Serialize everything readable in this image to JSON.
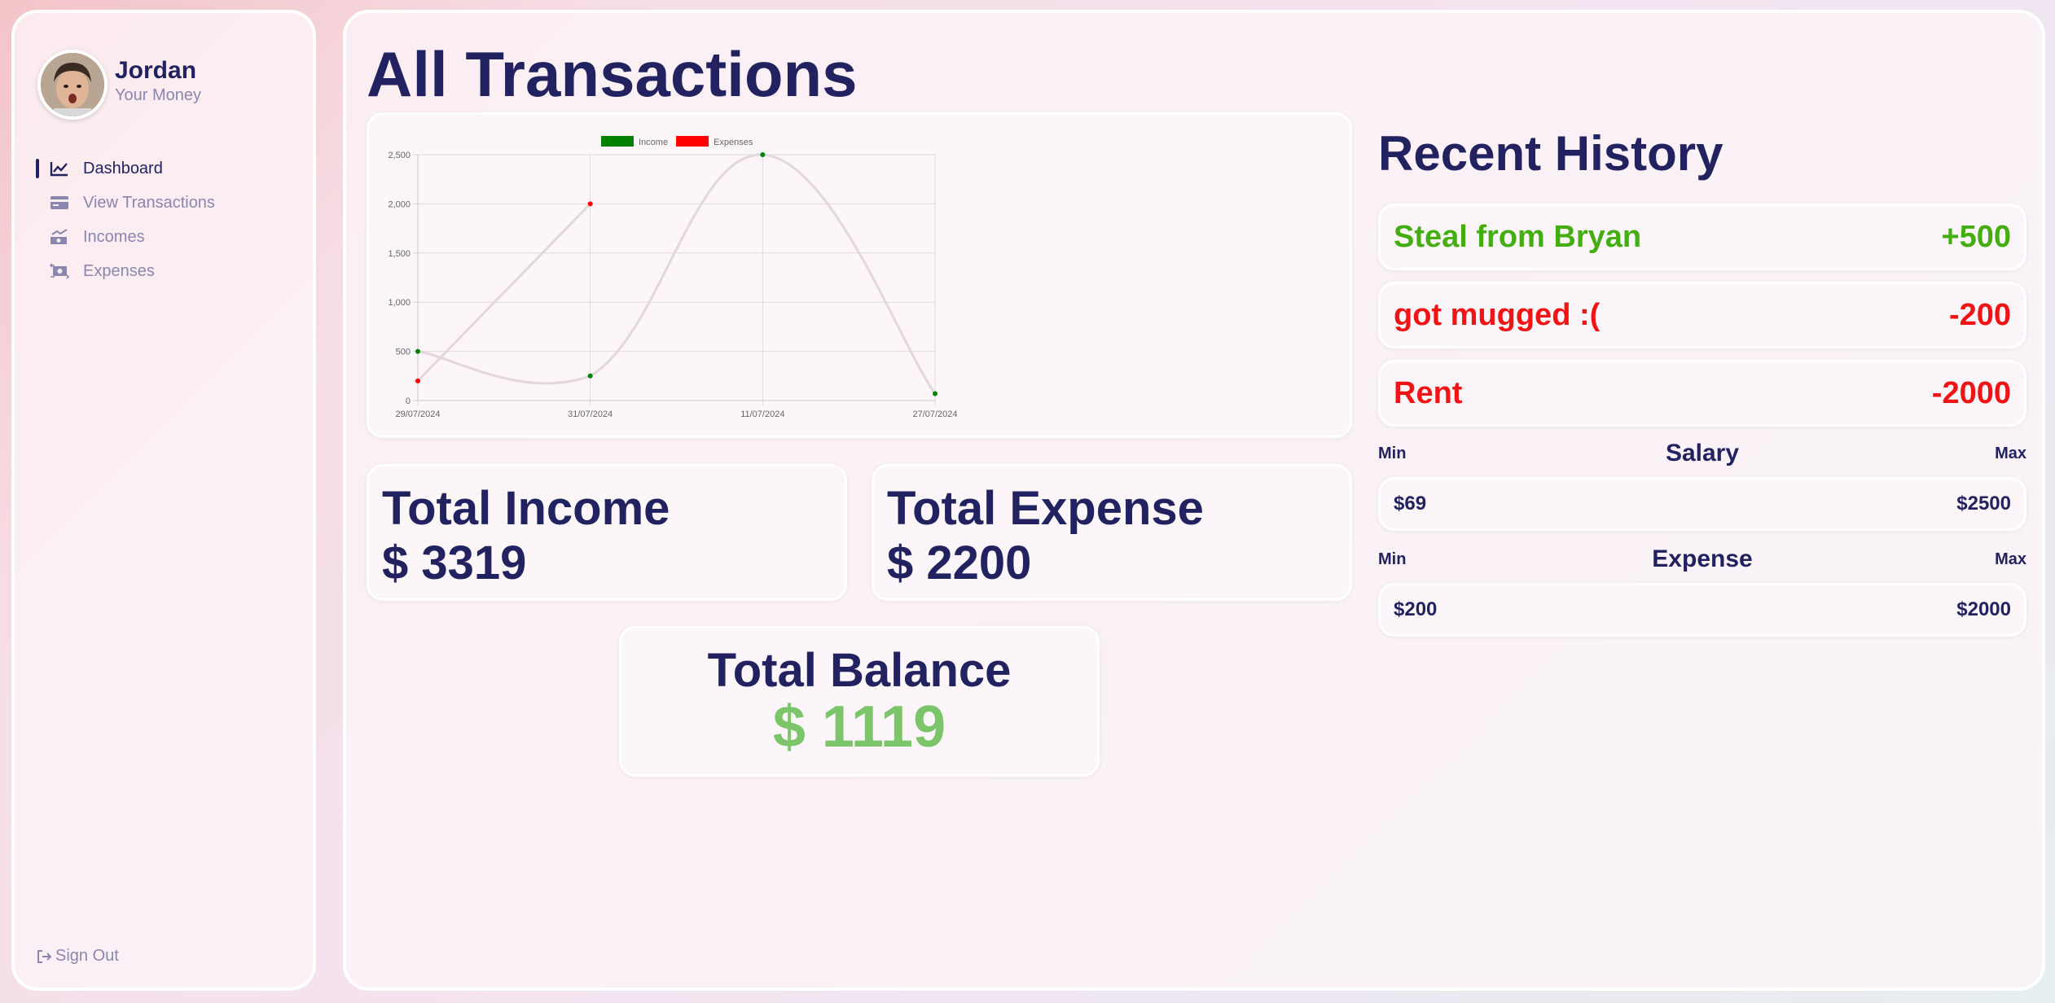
{
  "user": {
    "name": "Jordan",
    "subtitle": "Your Money"
  },
  "nav": {
    "items": [
      {
        "label": "Dashboard",
        "icon": "line-chart-icon",
        "active": true
      },
      {
        "label": "View Transactions",
        "icon": "credit-card-icon",
        "active": false
      },
      {
        "label": "Incomes",
        "icon": "money-trend-icon",
        "active": false
      },
      {
        "label": "Expenses",
        "icon": "money-exchange-icon",
        "active": false
      }
    ],
    "signout_label": "Sign Out"
  },
  "main": {
    "title": "All Transactions"
  },
  "chart_data": {
    "type": "line",
    "categories": [
      "29/07/2024",
      "31/07/2024",
      "11/07/2024",
      "27/07/2024"
    ],
    "series": [
      {
        "name": "Income",
        "color": "#008000",
        "values": [
          500,
          250,
          2500,
          70
        ]
      },
      {
        "name": "Expenses",
        "color": "#ff0000",
        "values": [
          200,
          2000
        ]
      }
    ],
    "ylim": [
      0,
      2500
    ],
    "yticks": [
      0,
      500,
      1000,
      1500,
      2000,
      2500
    ],
    "ytick_labels": [
      "0",
      "500",
      "1,000",
      "1,500",
      "2,000",
      "2,500"
    ],
    "grid": true,
    "legend": "top",
    "line_color": "#e2d8dc"
  },
  "totals": {
    "income_label": "Total Income",
    "income_value": "$ 3319",
    "expense_label": "Total Expense",
    "expense_value": "$ 2200",
    "balance_label": "Total Balance",
    "balance_value": "$ 1119"
  },
  "history": {
    "title": "Recent History",
    "items": [
      {
        "name": "Steal from Bryan",
        "amount": "+500",
        "type": "income"
      },
      {
        "name": "got mugged :(",
        "amount": "-200",
        "type": "expense"
      },
      {
        "name": "Rent",
        "amount": "-2000",
        "type": "expense"
      }
    ]
  },
  "salary": {
    "min_label": "Min",
    "title": "Salary",
    "max_label": "Max",
    "min_value": "$69",
    "max_value": "$2500"
  },
  "expense_range": {
    "min_label": "Min",
    "title": "Expense",
    "max_label": "Max",
    "min_value": "$200",
    "max_value": "$2000"
  },
  "colors": {
    "navy": "#222260",
    "muted": "#8a86ad",
    "income": "#44ad12",
    "expense": "#f01414",
    "balance": "#7dc56a"
  }
}
